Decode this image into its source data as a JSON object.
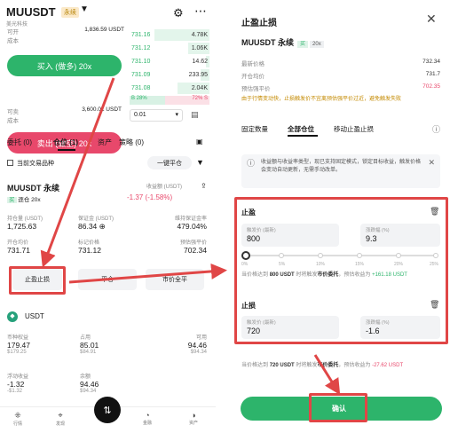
{
  "left": {
    "header": {
      "symbol": "MUUSDT",
      "tag": "永续",
      "subtitle": "美光科技"
    },
    "order": {
      "avail1_label": "可开",
      "avail1_value": "1,836.59 USDT",
      "cost1_label": "成本",
      "cost1_value": "",
      "buy_label": "买入 (做多) 20x",
      "avail2_label": "可卖",
      "avail2_value": "3,600.01 USDT",
      "cost2_label": "成本",
      "cost2_value": "",
      "sell_label": "卖出 (做空) 20x"
    },
    "orderbook": {
      "rows": [
        {
          "price": "731.16",
          "qty": "4.78K"
        },
        {
          "price": "731.12",
          "qty": "1.06K"
        },
        {
          "price": "731.10",
          "qty": "14.62"
        },
        {
          "price": "731.09",
          "qty": "233.95"
        },
        {
          "price": "731.08",
          "qty": "2.04K"
        }
      ],
      "buy_pct": "B 28%",
      "sell_pct": "72% S",
      "precision": "0.01"
    },
    "tabs": [
      "委托 (0)",
      "仓位 (1)",
      "资产",
      "策略 (0)"
    ],
    "hide_other": "当前交易品种",
    "close_all": "一键平仓",
    "position": {
      "symbol": "MUUSDT 永续",
      "badge_buy": "买",
      "badge_mode": "逐仓",
      "leverage": "20x",
      "pnl_label": "收益额 (USDT)",
      "pnl_value": "-1.37 (-1.58%)",
      "size_label": "持仓量 (USDT)",
      "size_value": "1,725.63",
      "margin_label": "保证金 (USDT)",
      "margin_value": "86.34",
      "ratio_label": "维持保证金率",
      "ratio_value": "479.04%",
      "entry_label": "开仓均价",
      "entry_value": "731.71",
      "mark_label": "标记价格",
      "mark_value": "731.12",
      "liq_label": "预估强平价",
      "liq_value": "702.34",
      "btn_tpsl": "止盈止损",
      "btn_close": "平仓",
      "btn_market": "市价全平"
    },
    "asset": {
      "coin": "USDT",
      "equity_label": "币种权益",
      "equity_value": "179.47",
      "equity_sub": "$179.25",
      "used_label": "占用",
      "used_value": "85.01",
      "used_sub": "$84.91",
      "avail_label": "可用",
      "avail_value": "94.46",
      "avail_sub": "$94.34",
      "upnl_label": "浮动收益",
      "upnl_value": "-1.32",
      "upnl_sub": "-$1.32",
      "usable_label": "余额",
      "usable_value": "94.46",
      "usable_sub": "$94.34"
    },
    "nav": [
      "行情",
      "发现",
      "交易",
      "金融",
      "资产"
    ]
  },
  "right": {
    "title": "止盈止损",
    "symbol": "MUUSDT 永续",
    "badge_buy": "买",
    "leverage": "20x",
    "latest_label": "最新价格",
    "latest_value": "732.34",
    "entry_label": "开仓均价",
    "entry_value": "731.7",
    "liq_label": "预估强平价",
    "liq_value": "702.35",
    "warning": "由于行情变动快，止损触发价不宜离预估强平价过近，避免触发失败",
    "tabs": [
      "固定数量",
      "全部仓位",
      "移动止盈止损"
    ],
    "notice": "收益额与收益率类型，现已支持固定模式，锁定目标收益，触发价格会变动自动更新，无需手动改单。",
    "tp": {
      "title": "止盈",
      "trigger_label": "触发价 (最新)",
      "trigger_value": "800",
      "pct_label": "涨跌幅 (%)",
      "pct_value": "9.3",
      "ticks": [
        "0%",
        "5%",
        "10%",
        "15%",
        "20%",
        "25%"
      ],
      "est_prefix": "当价格达到",
      "est_price": "800 USDT",
      "est_mid": "时将触发",
      "est_type": "市价委托",
      "est_pnl_label": "，预估收益为",
      "est_pnl": "+161.18 USDT"
    },
    "sl": {
      "title": "止损",
      "trigger_label": "触发价 (最新)",
      "trigger_value": "720",
      "pct_label": "涨跌幅 (%)",
      "pct_value": "-1.6",
      "est_prefix": "当价格达到",
      "est_price": "720 USDT",
      "est_mid": "时将触发",
      "est_type": "市价委托",
      "est_pnl_label": "，预估收益为",
      "est_pnl": "-27.62 USDT"
    },
    "confirm_label": "确认"
  },
  "colors": {
    "green": "#2db46b",
    "red": "#e8486b",
    "highlight": "#e04646"
  }
}
